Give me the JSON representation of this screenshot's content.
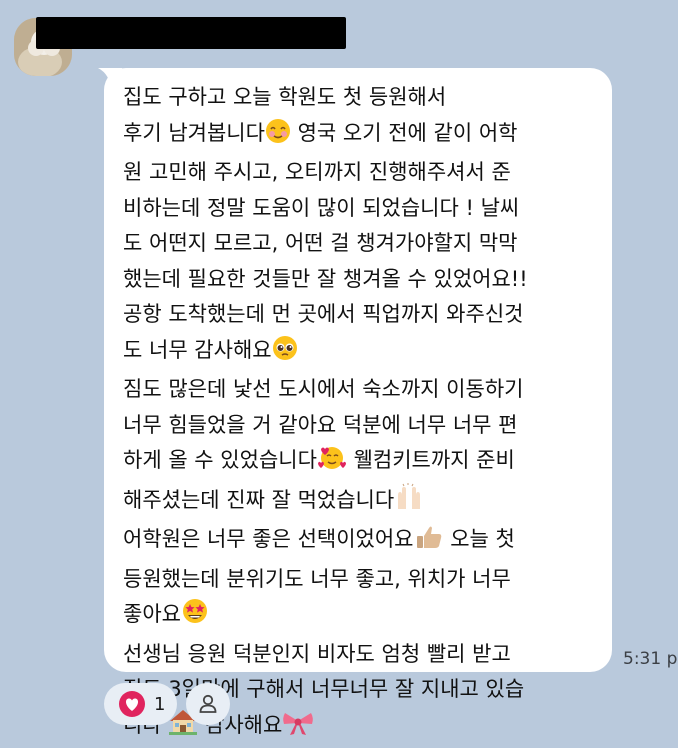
{
  "message": {
    "lines": [
      "집도 구하고 오늘 학원도 첫 등원해서",
      "후기 남겨봅니다",
      " 영국 오기 전에 같이 어학",
      "원 고민해 주시고, 오티까지 진행해주셔서 준",
      "비하는데 정말 도움이 많이 되었습니다 ! 날씨",
      "도 어떤지 모르고, 어떤 걸 챙겨가야할지 막막",
      "했는데 필요한 것들만 잘 챙겨올 수 있었어요!!",
      "공항 도착했는데 먼 곳에서 픽업까지 와주신것",
      "도 너무 감사해요",
      "짐도 많은데 낯선 도시에서 숙소까지 이동하기",
      "너무 힘들었을 거 같아요 덕분에 너무 너무 편",
      "하게 올 수 있었습니다",
      " 웰컴키트까지 준비",
      "해주셨는데 진짜 잘 먹었습니다",
      "어학원은 너무 좋은 선택이었어요",
      " 오늘 첫",
      "등원했는데 분위기도 너무 좋고, 위치가 너무",
      "좋아요",
      "선생님 응원 덕분인지 비자도 엄청 빨리 받고",
      "집도 3일만에 구해서 너무너무 잘 지내고 있습",
      "니다 ",
      " 감사해요"
    ]
  },
  "emojis": {
    "smiling": "smiling-face-icon",
    "pleading": "pleading-face-icon",
    "hearts": "smiling-face-with-hearts-icon",
    "hands": "raising-hands-icon",
    "thumbs": "thumbs-up-icon",
    "starstruck": "star-struck-icon",
    "house": "house-icon",
    "ribbon": "ribbon-icon"
  },
  "timestamp": "5:31 p",
  "reaction": {
    "icon": "heart-icon",
    "count": "1"
  },
  "add_reaction_icon": "person-icon",
  "colors": {
    "background": "#b9c9dc",
    "bubble": "#ffffff",
    "heart": "#e0245e",
    "pill": "#e8eef5"
  }
}
